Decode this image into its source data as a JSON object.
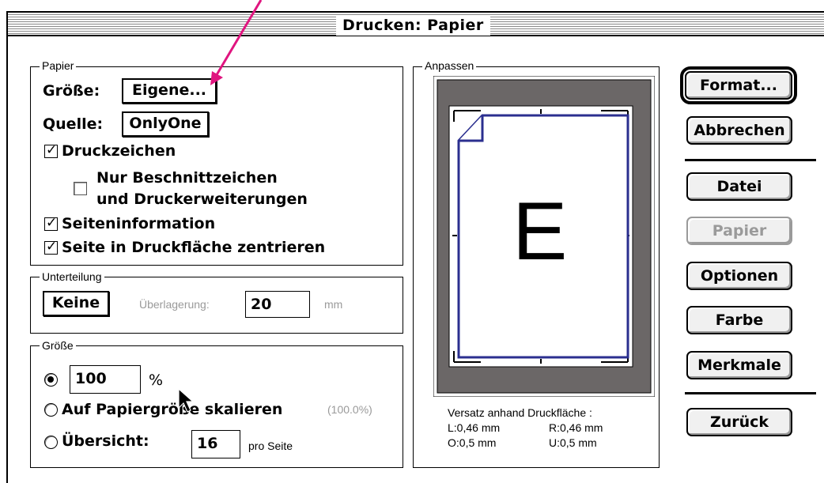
{
  "window": {
    "title": "Drucken: Papier"
  },
  "papier": {
    "group_label": "Papier",
    "groesse_label": "Größe:",
    "groesse_value": "Eigene...",
    "quelle_label": "Quelle:",
    "quelle_value": "OnlyOne",
    "druckzeichen": "Druckzeichen",
    "nur_beschnitt_line1": "Nur Beschnittzeichen",
    "nur_beschnitt_line2": "und Druckerweiterungen",
    "seiteninformation": "Seiteninformation",
    "zentrieren": "Seite in Druckfläche zentrieren"
  },
  "unterteilung": {
    "group_label": "Unterteilung",
    "mode": "Keine",
    "overlap_label": "Überlagerung:",
    "overlap_value": "20",
    "unit": "mm"
  },
  "groesse": {
    "group_label": "Größe",
    "percent_value": "100",
    "percent_sign": "%",
    "scale_label": "Auf Papiergröße skalieren",
    "scale_value": "(100.0%)",
    "uebersicht_label": "Übersicht:",
    "uebersicht_value": "16",
    "pro_seite": "pro Seite",
    "selected_option": "percent"
  },
  "anpassen": {
    "group_label": "Anpassen",
    "preview_letter": "E",
    "versatz_title": "Versatz anhand Druckfläche :",
    "l": "L:0,46 mm",
    "r": "R:0,46 mm",
    "o": "O:0,5 mm",
    "u": "U:0,5 mm"
  },
  "buttons": {
    "format": "Format...",
    "abbrechen": "Abbrechen",
    "datei": "Datei",
    "papier": "Papier",
    "optionen": "Optionen",
    "farbe": "Farbe",
    "merkmale": "Merkmale",
    "zurueck": "Zurück"
  },
  "colors": {
    "annotation_arrow": "#e0157f",
    "preview_outline": "#2b2f8f",
    "preview_bg": "#6b6767"
  }
}
